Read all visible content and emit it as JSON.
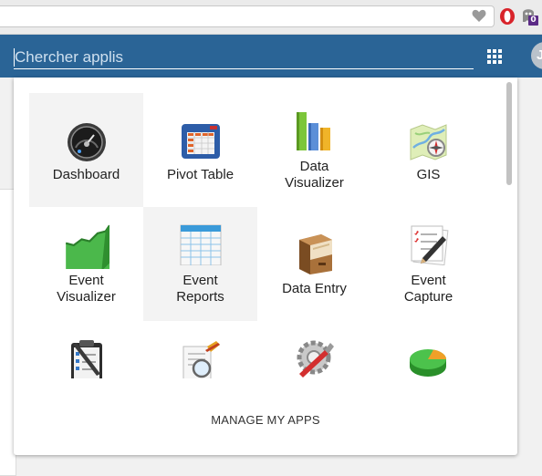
{
  "browser": {
    "heart_icon": "heart-icon",
    "extensions": [
      {
        "name": "opera-icon",
        "color": "#d8232a"
      },
      {
        "name": "ghostery-icon",
        "badge": "0",
        "badge_color": "#5b2a86"
      }
    ]
  },
  "header": {
    "color": "#2a6496",
    "search_placeholder": "Chercher applis",
    "avatar_initial": "J"
  },
  "apps": [
    {
      "label": "Dashboard",
      "icon": "dashboard-gauge-icon",
      "highlighted": true
    },
    {
      "label": "Pivot Table",
      "icon": "pivot-table-icon",
      "highlighted": false
    },
    {
      "label": "Data Visualizer",
      "icon": "bar-chart-icon",
      "highlighted": false
    },
    {
      "label": "GIS",
      "icon": "map-compass-icon",
      "highlighted": false
    },
    {
      "label": "Event Visualizer",
      "icon": "area-chart-icon",
      "highlighted": false
    },
    {
      "label": "Event Reports",
      "icon": "report-table-icon",
      "highlighted": true
    },
    {
      "label": "Data Entry",
      "icon": "filing-cabinet-icon",
      "highlighted": false
    },
    {
      "label": "Event Capture",
      "icon": "checklist-pen-icon",
      "highlighted": false
    },
    {
      "label": "",
      "icon": "clipboard-checklist-icon",
      "highlighted": false
    },
    {
      "label": "",
      "icon": "magnifier-document-icon",
      "highlighted": false
    },
    {
      "label": "",
      "icon": "gear-tools-icon",
      "highlighted": false
    },
    {
      "label": "",
      "icon": "pie-chart-icon",
      "highlighted": false
    }
  ],
  "footer": {
    "manage_label": "MANAGE MY APPS"
  }
}
